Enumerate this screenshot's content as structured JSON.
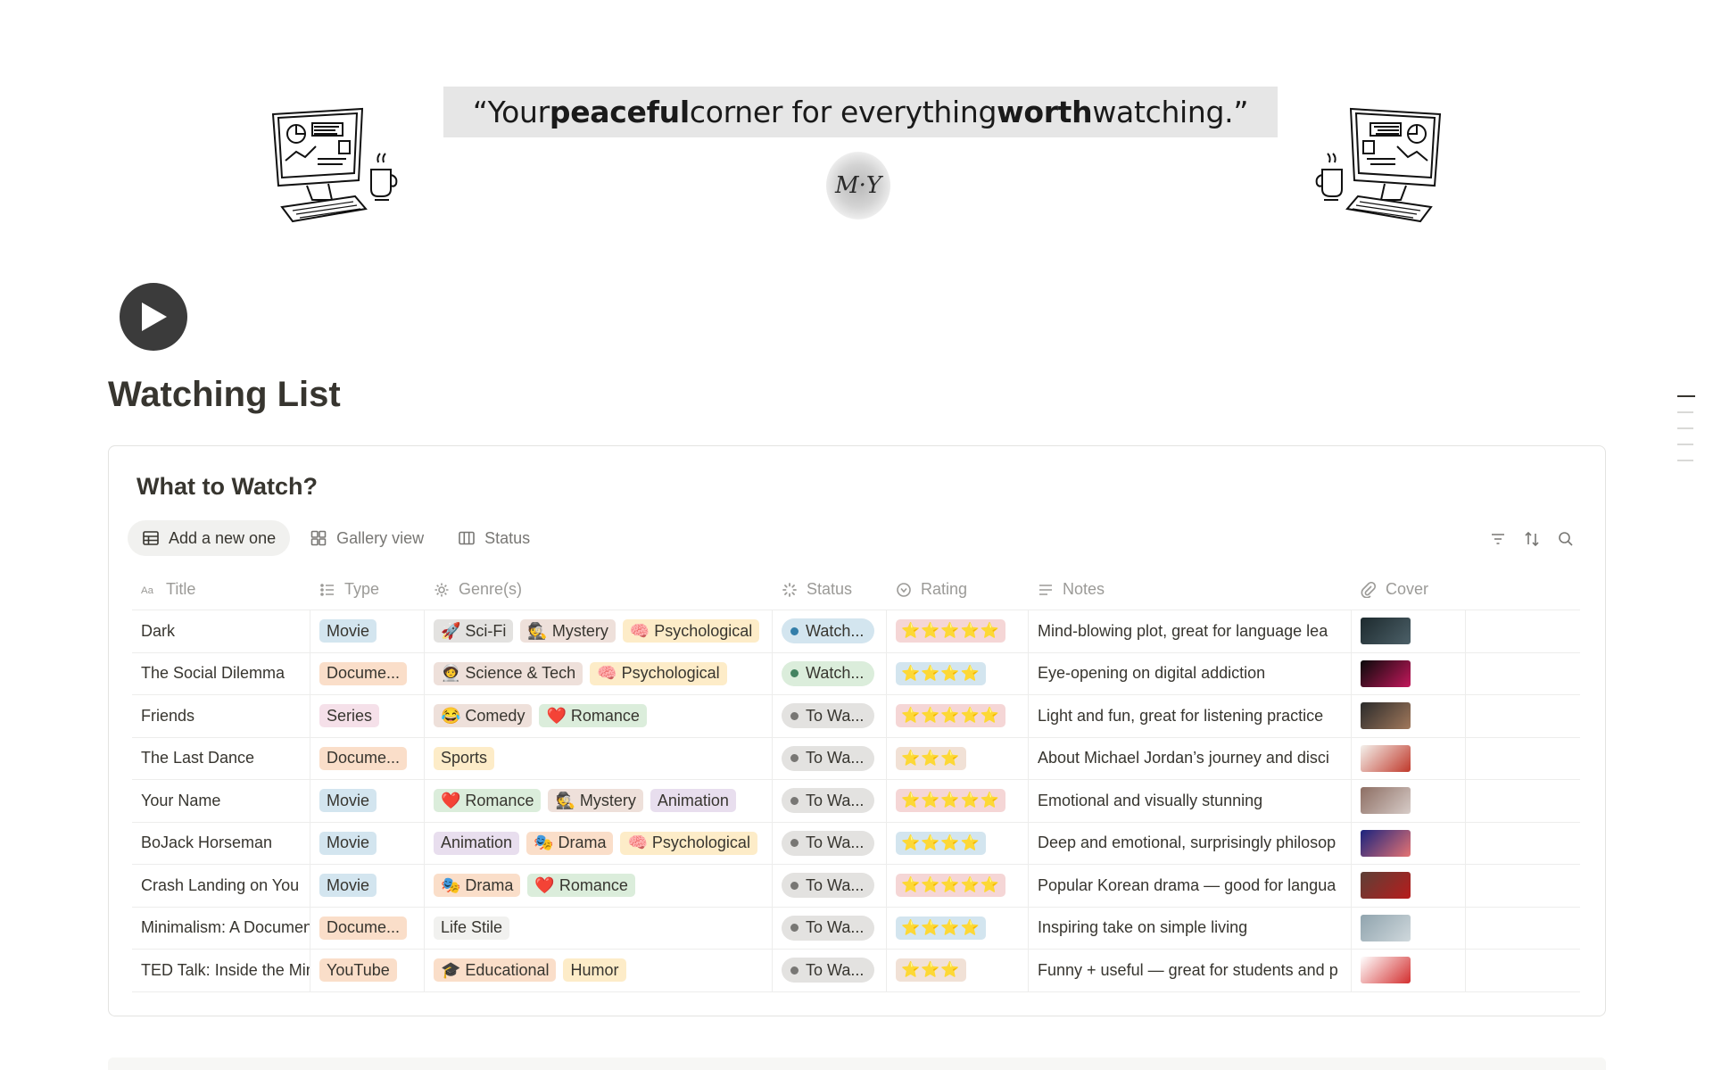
{
  "banner": {
    "quote_open": "“Your ",
    "quote_b1": "peaceful",
    "quote_mid": " corner for everything ",
    "quote_b2": "worth",
    "quote_end": " watching.”",
    "monogram": "M·Y"
  },
  "page": {
    "title": "Watching List",
    "icon": "play-icon"
  },
  "database": {
    "title": "What to Watch?",
    "views": [
      {
        "label": "Add a new one",
        "icon": "table-icon",
        "active": true
      },
      {
        "label": "Gallery view",
        "icon": "gallery-icon",
        "active": false
      },
      {
        "label": "Status",
        "icon": "board-icon",
        "active": false
      }
    ],
    "tools": [
      "filter-icon",
      "sort-icon",
      "search-icon"
    ],
    "columns": {
      "title": "Title",
      "type": "Type",
      "genre": "Genre(s)",
      "status": "Status",
      "rating": "Rating",
      "notes": "Notes",
      "cover": "Cover"
    },
    "rows": [
      {
        "title": "Dark",
        "type": "Movie",
        "type_color": "blue",
        "genres": [
          {
            "label": "🚀 Sci-Fi",
            "color": "gray"
          },
          {
            "label": "🕵️ Mystery",
            "color": "brown"
          },
          {
            "label": "🧠 Psychological",
            "color": "yellow"
          }
        ],
        "status": "Watch...",
        "status_kind": "watching-blue",
        "rating": "⭐⭐⭐⭐⭐",
        "rating_color": "pink",
        "notes": "Mind-blowing plot, great for language lea",
        "cover_colors": [
          "#1d2a2e",
          "#4c6068"
        ]
      },
      {
        "title": "The Social Dilemma",
        "type": "Docume...",
        "type_color": "orange",
        "genres": [
          {
            "label": "🧑‍🚀 Science & Tech",
            "color": "brown"
          },
          {
            "label": "🧠 Psychological",
            "color": "yellow"
          }
        ],
        "status": "Watch...",
        "status_kind": "watching-green",
        "rating": "⭐⭐⭐⭐",
        "rating_color": "blue",
        "notes": "Eye-opening on digital addiction",
        "cover_colors": [
          "#0a0a0a",
          "#c2185b"
        ]
      },
      {
        "title": "Friends",
        "type": "Series",
        "type_color": "pink",
        "genres": [
          {
            "label": "😂 Comedy",
            "color": "brown"
          },
          {
            "label": "❤️ Romance",
            "color": "green"
          }
        ],
        "status": "To Wa...",
        "status_kind": "towatch",
        "rating": "⭐⭐⭐⭐⭐",
        "rating_color": "pink",
        "notes": "Light and fun, great for listening practice",
        "cover_colors": [
          "#2b2b2b",
          "#a1785b"
        ]
      },
      {
        "title": "The Last Dance",
        "type": "Docume...",
        "type_color": "orange",
        "genres": [
          {
            "label": "Sports",
            "color": "yellow"
          }
        ],
        "status": "To Wa...",
        "status_kind": "towatch",
        "rating": "⭐⭐⭐",
        "rating_color": "brown",
        "notes": "About Michael Jordan’s journey and disci",
        "cover_colors": [
          "#f4f1ec",
          "#c0392b"
        ]
      },
      {
        "title": "Your Name",
        "type": "Movie",
        "type_color": "blue",
        "genres": [
          {
            "label": "❤️ Romance",
            "color": "green"
          },
          {
            "label": "🕵️ Mystery",
            "color": "brown"
          },
          {
            "label": "Animation",
            "color": "purple"
          }
        ],
        "status": "To Wa...",
        "status_kind": "towatch",
        "rating": "⭐⭐⭐⭐⭐",
        "rating_color": "pink",
        "notes": "Emotional and visually stunning",
        "cover_colors": [
          "#8d6e63",
          "#d7ccc8"
        ]
      },
      {
        "title": "BoJack Horseman",
        "type": "Movie",
        "type_color": "blue",
        "genres": [
          {
            "label": "Animation",
            "color": "purple"
          },
          {
            "label": "🎭 Drama",
            "color": "orange"
          },
          {
            "label": "🧠 Psychological",
            "color": "yellow"
          }
        ],
        "status": "To Wa...",
        "status_kind": "towatch",
        "rating": "⭐⭐⭐⭐",
        "rating_color": "blue",
        "notes": "Deep and emotional, surprisingly philosop",
        "cover_colors": [
          "#1a237e",
          "#e57373"
        ]
      },
      {
        "title": "Crash Landing on You",
        "type": "Movie",
        "type_color": "blue",
        "genres": [
          {
            "label": "🎭 Drama",
            "color": "orange"
          },
          {
            "label": "❤️ Romance",
            "color": "green"
          }
        ],
        "status": "To Wa...",
        "status_kind": "towatch",
        "rating": "⭐⭐⭐⭐⭐",
        "rating_color": "pink",
        "notes": "Popular Korean drama — good for langua",
        "cover_colors": [
          "#5d4037",
          "#b71c1c"
        ]
      },
      {
        "title": "Minimalism: A Documentary",
        "type": "Docume...",
        "type_color": "orange",
        "genres": [
          {
            "label": "Life Stile",
            "color": "lgray"
          }
        ],
        "status": "To Wa...",
        "status_kind": "towatch",
        "rating": "⭐⭐⭐⭐",
        "rating_color": "blue",
        "notes": "Inspiring take on simple living",
        "cover_colors": [
          "#90a4ae",
          "#cfd8dc"
        ]
      },
      {
        "title": "TED Talk: Inside the Mind",
        "type": "YouTube",
        "type_color": "orange",
        "genres": [
          {
            "label": "🎓 Educational",
            "color": "orange"
          },
          {
            "label": "Humor",
            "color": "yellow"
          }
        ],
        "status": "To Wa...",
        "status_kind": "towatch",
        "rating": "⭐⭐⭐",
        "rating_color": "brown",
        "notes": "Funny + useful — great for students and p",
        "cover_colors": [
          "#ffffff",
          "#d32f2f"
        ]
      }
    ]
  }
}
